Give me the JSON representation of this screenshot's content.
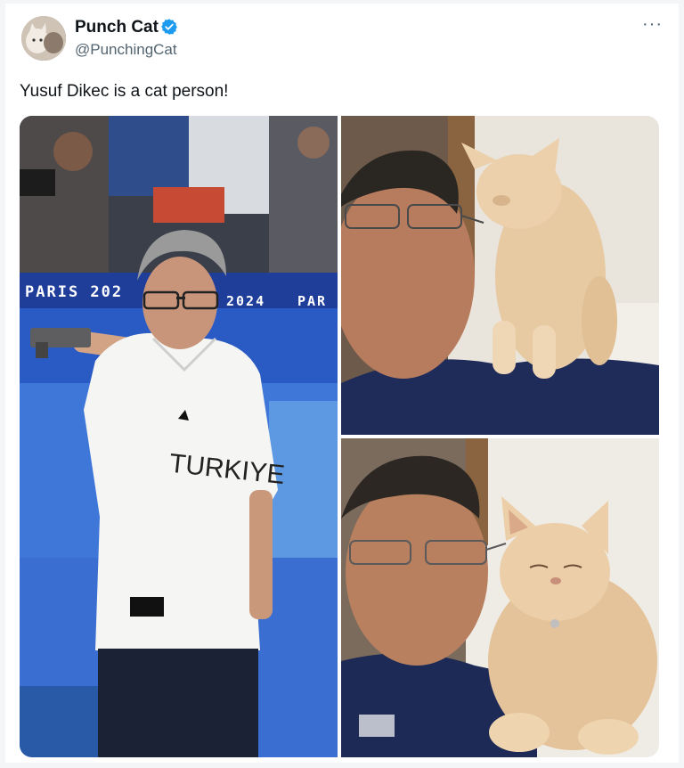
{
  "author": {
    "name": "Punch Cat",
    "handle": "@PunchingCat",
    "verified": true,
    "avatar_icon": "cat-avatar"
  },
  "menu": {
    "more_label": "···"
  },
  "tweet": {
    "text": "Yusuf Dikec is a cat person!"
  },
  "media": {
    "photo1": {
      "banner_left": "PARIS 202",
      "banner_mid": "2024",
      "banner_right": "PAR",
      "shirt_text": "TURKIYE"
    }
  },
  "colors": {
    "verified": "#1d9bf0",
    "text_primary": "#0f1419",
    "text_secondary": "#536471"
  }
}
